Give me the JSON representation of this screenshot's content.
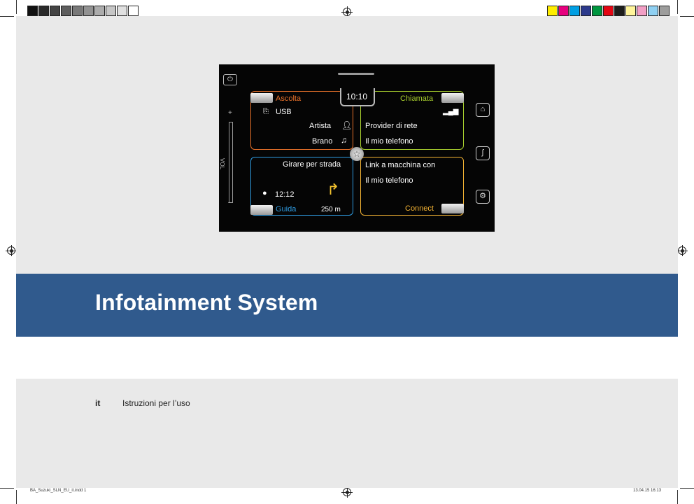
{
  "screen": {
    "clock": "10:10",
    "listen": {
      "title": "Ascolta",
      "source": "USB",
      "artist_label": "Artista",
      "track_label": "Brano"
    },
    "call": {
      "title": "Chiamata",
      "provider_label": "Provider di rete",
      "phone_label": "Il mio telefono"
    },
    "guide": {
      "title": "Guida",
      "instruction": "Girare per strada",
      "time": "12:12",
      "distance": "250 m"
    },
    "connect": {
      "title": "Connect",
      "line1": "Link a macchina con",
      "line2": "Il mio telefono"
    },
    "volume_label": "VOL",
    "colors": {
      "listen": "#e8712a",
      "call": "#a8cf2e",
      "guide": "#2f9be0",
      "connect": "#f2b233"
    }
  },
  "document": {
    "title": "Infotainment System",
    "lang_code": "it",
    "lang_description": "Istruzioni per l’uso"
  },
  "print": {
    "slug_left": "BA_Suzuki_SLN_EU_it.indd   1",
    "slug_right": "13.04.15   16:13",
    "colors": {
      "band": "#305a8d",
      "panel": "#e9e9e9"
    }
  }
}
